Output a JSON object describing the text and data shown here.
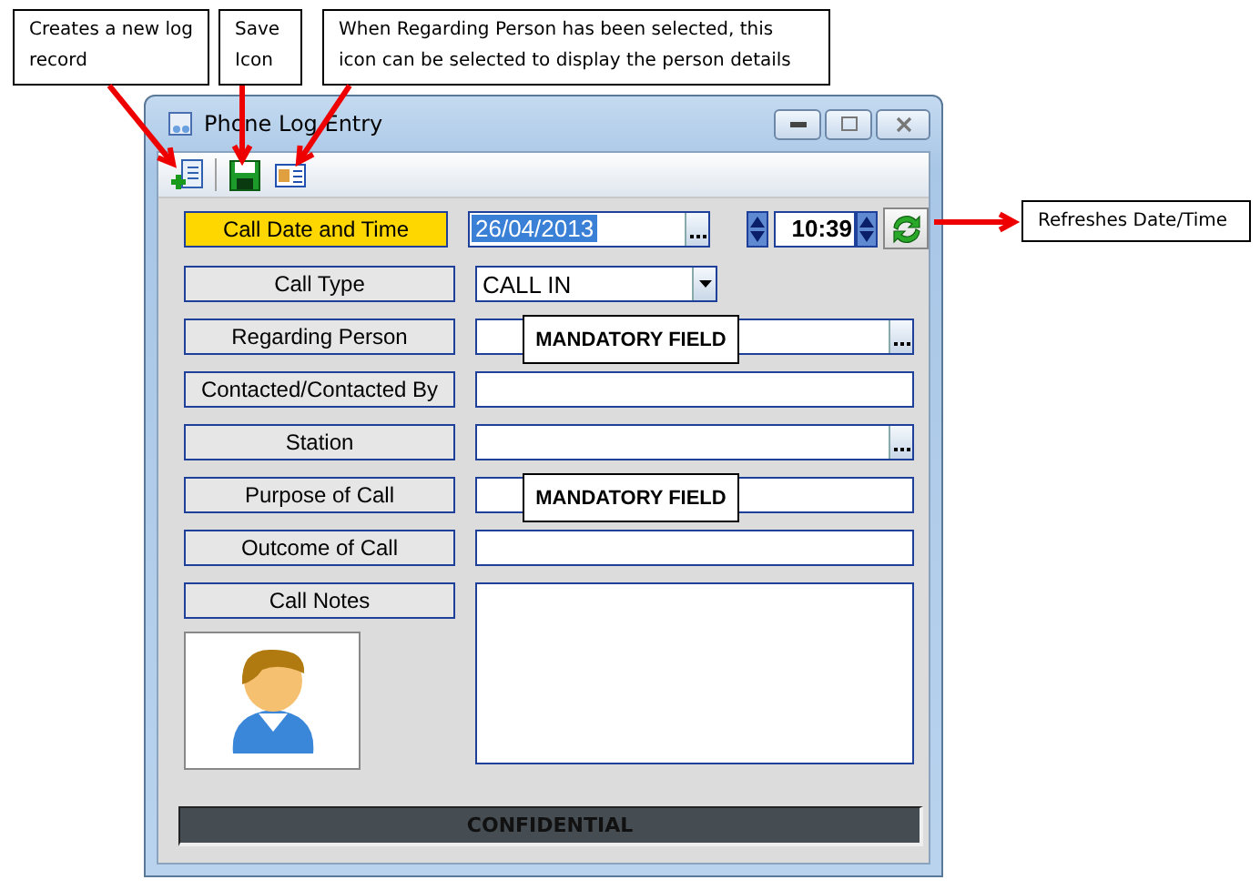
{
  "callouts": [
    {
      "text": "Creates a new log record"
    },
    {
      "text": "Save Icon"
    },
    {
      "text": "When Regarding Person has been selected, this icon can be selected to display the person details"
    },
    {
      "text": "Refreshes Date/Time"
    }
  ],
  "window": {
    "title": "Phone Log Entry"
  },
  "form": {
    "rows": [
      {
        "label": "Call Date and Time",
        "kind": "datetime",
        "focused": true,
        "value": "26/04/2013",
        "time": "10:39"
      },
      {
        "label": "Call Type",
        "kind": "combo",
        "focused": false,
        "value": "CALL IN"
      },
      {
        "label": "Regarding Person",
        "kind": "lookup",
        "focused": false,
        "note": "MANDATORY FIELD"
      },
      {
        "label": "Contacted/Contacted By",
        "kind": "text",
        "focused": false
      },
      {
        "label": "Station",
        "kind": "lookup",
        "focused": false
      },
      {
        "label": "Purpose of Call",
        "kind": "text",
        "focused": false,
        "note": "MANDATORY FIELD"
      },
      {
        "label": "Outcome of Call",
        "kind": "text",
        "focused": false
      },
      {
        "label": "Call Notes",
        "kind": "memo",
        "focused": false
      }
    ]
  },
  "status_bar": {
    "text": "CONFIDENTIAL"
  }
}
